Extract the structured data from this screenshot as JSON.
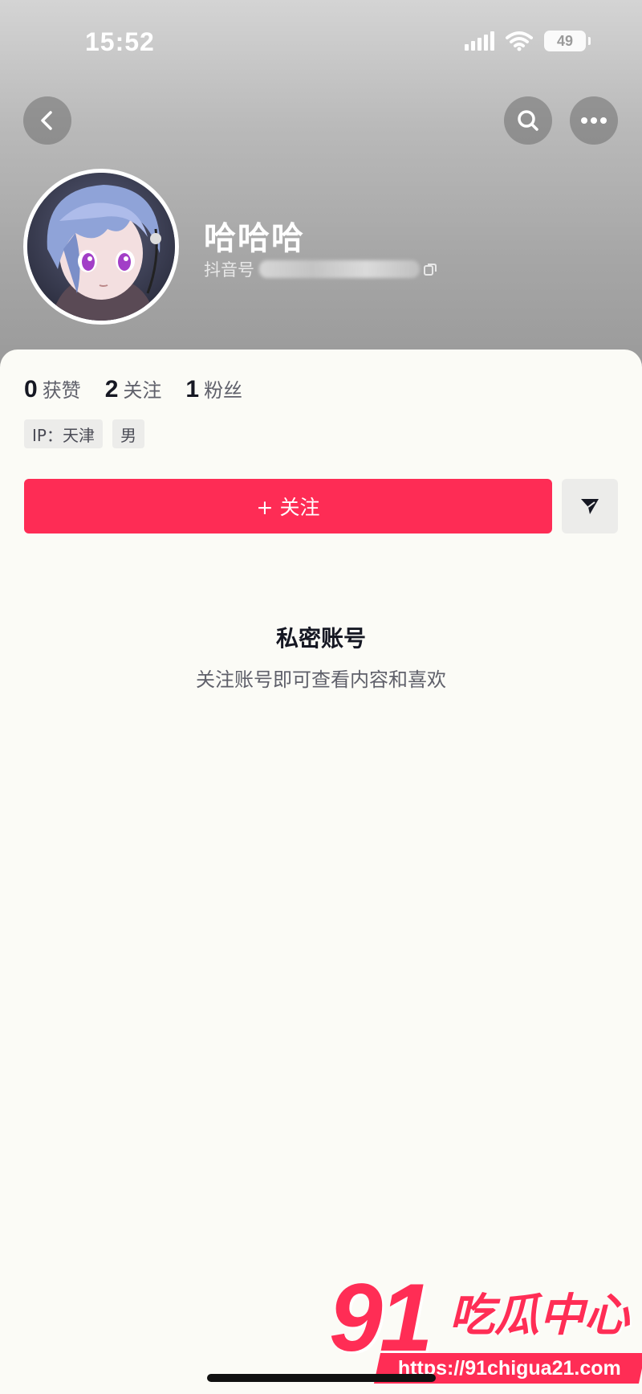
{
  "status_bar": {
    "time": "15:52",
    "battery": "49"
  },
  "profile": {
    "name": "哈哈哈",
    "id_label": "抖音号"
  },
  "stats": [
    {
      "value": "0",
      "label": "获赞"
    },
    {
      "value": "2",
      "label": "关注"
    },
    {
      "value": "1",
      "label": "粉丝"
    }
  ],
  "tags": [
    "IP：天津",
    "男"
  ],
  "actions": {
    "follow_label": "+ 关注"
  },
  "private_notice": {
    "title": "私密账号",
    "description": "关注账号即可查看内容和喜欢"
  },
  "watermark": {
    "number": "91",
    "text": "吃瓜中心",
    "url": "https://91chigua21.com"
  },
  "colors": {
    "accent": "#fe2c55",
    "text_primary": "#161823",
    "text_secondary": "#5f606a"
  },
  "icons": {
    "back": "chevron-left-icon",
    "search": "search-icon",
    "more": "more-horizontal-icon",
    "share": "send-icon"
  }
}
